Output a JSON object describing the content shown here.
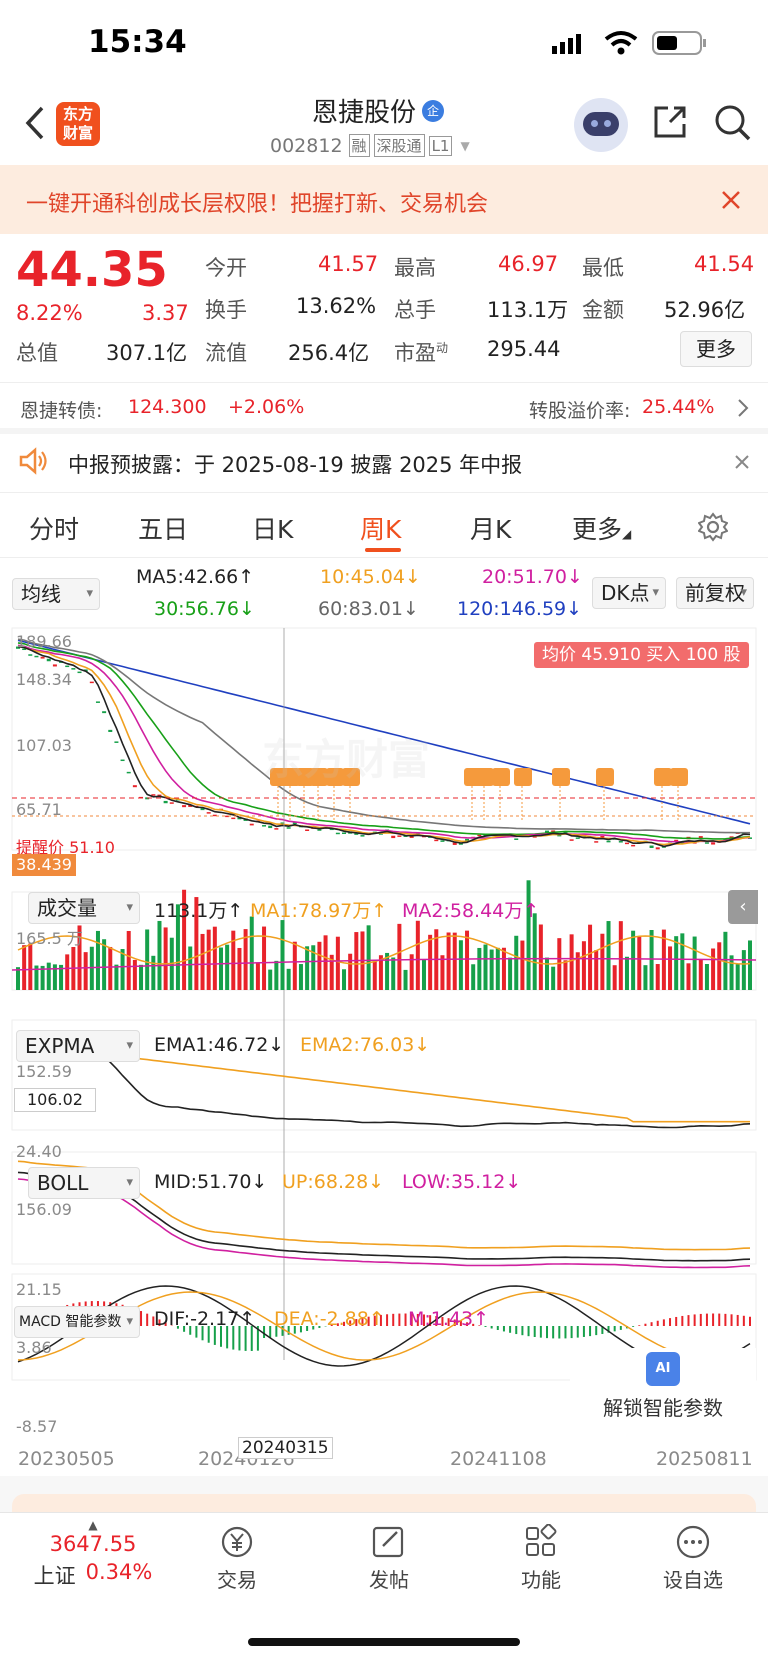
{
  "status": {
    "time": "15:34"
  },
  "header": {
    "stock_name": "恩捷股份",
    "stock_badge": "企",
    "stock_code": "002812",
    "tags": [
      "融",
      "深股通",
      "L1"
    ],
    "logo_line1": "东方",
    "logo_line2": "财富"
  },
  "banner": {
    "text": "一键开通科创成长层权限！把握打新、交易机会"
  },
  "quote": {
    "price": "44.35",
    "pct": "8.22%",
    "chg": "3.37",
    "r1": [
      {
        "l": "今开",
        "v": "41.57"
      },
      {
        "l": "最高",
        "v": "46.97"
      },
      {
        "l": "最低",
        "v": "41.54"
      }
    ],
    "r2": [
      {
        "l": "换手",
        "v": "13.62%"
      },
      {
        "l": "总手",
        "v": "113.1万"
      },
      {
        "l": "金额",
        "v": "52.96亿"
      }
    ],
    "r3": [
      {
        "l": "总值",
        "v": "307.1亿"
      },
      {
        "l": "流值",
        "v": "256.4亿"
      },
      {
        "l": "市盈",
        "sup": "动",
        "v": "295.44"
      }
    ],
    "more": "更多"
  },
  "bond": {
    "label": "恩捷转债:",
    "price": "124.300",
    "pct": "+2.06%",
    "prem_label": "转股溢价率:",
    "prem": "25.44%"
  },
  "notice": {
    "text": "中报预披露：于 2025-08-19 披露 2025 年中报"
  },
  "tabs": [
    "分时",
    "五日",
    "日K",
    "周K",
    "月K",
    "更多"
  ],
  "active_tab": "周K",
  "ma": {
    "selector": "均线",
    "ma5": "MA5:42.66↑",
    "ma10": "10:45.04↓",
    "ma20": "20:51.70↓",
    "ma30": "30:56.76↓",
    "ma60": "60:83.01↓",
    "ma120": "120:146.59↓",
    "dk": "DK点",
    "fq": "前复权"
  },
  "kline": {
    "ticks": [
      "189.66",
      "148.34",
      "107.03",
      "65.71",
      "24.40"
    ],
    "avg": "均价 45.910 买入 100 股",
    "remind": "提醒价 51.10",
    "cross": "38.439",
    "watermark": "东方财富"
  },
  "vol": {
    "selector": "成交量",
    "val": "113.1万↑",
    "ma1": "MA1:78.97万↑",
    "ma2": "MA2:58.44万↑",
    "tick": "165.5 万"
  },
  "expma": {
    "selector": "EXPMA",
    "e1": "EMA1:46.72↓",
    "e2": "EMA2:76.03↓",
    "t1": "152.59",
    "t2": "24.40",
    "cross": "106.02"
  },
  "boll": {
    "selector": "BOLL",
    "mid": "MID:51.70↓",
    "up": "UP:68.28↓",
    "low": "LOW:35.12↓",
    "t1": "156.09",
    "t2": "21.15"
  },
  "macd": {
    "selector": "MACD 智能参数",
    "dif": "DIF:-2.17↑",
    "dea": "DEA:-2.88↑",
    "m": "M:1.43↑",
    "t1": "3.86",
    "t2": "-8.57",
    "unlock": "解锁智能参数",
    "ai": "AI"
  },
  "dates": [
    "20230505",
    "20240126",
    "20240315",
    "20241108",
    "20250811"
  ],
  "bottom": {
    "index_val": "3647.55",
    "index_name": "上证",
    "index_pct": "0.34%",
    "items": [
      "交易",
      "发帖",
      "功能",
      "设自选"
    ]
  }
}
